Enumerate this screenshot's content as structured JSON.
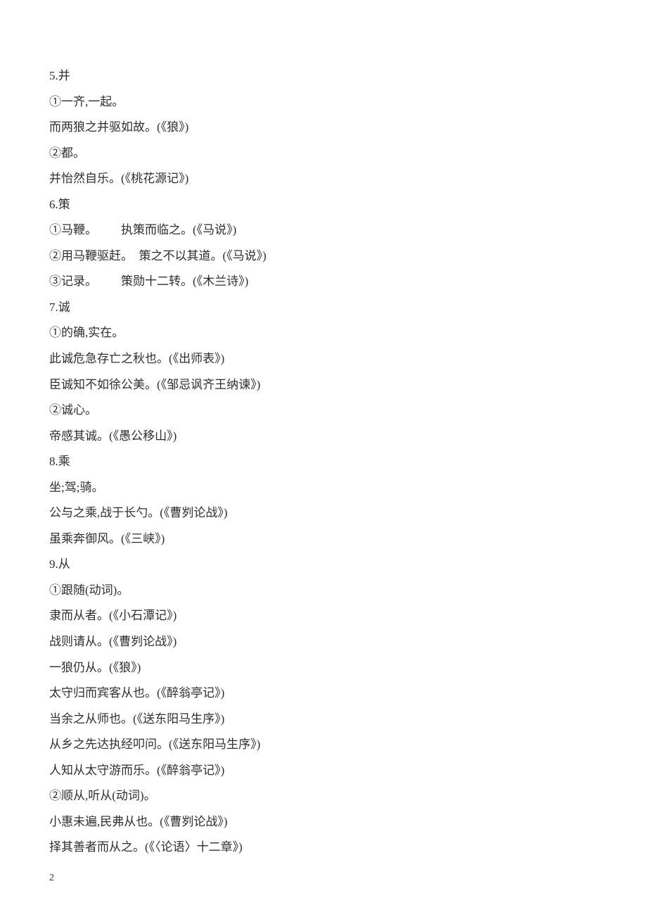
{
  "lines": [
    "5.并",
    "①一齐,一起。",
    "而两狼之并驱如故。(《狼》)",
    "②都。",
    "并怡然自乐。(《桃花源记》)",
    "6.策",
    "①马鞭。        执策而临之。(《马说》)",
    "②用马鞭驱赶。  策之不以其道。(《马说》)",
    "③记录。        策勋十二转。(《木兰诗》)",
    "7.诚",
    "①的确,实在。",
    "此诚危急存亡之秋也。(《出师表》)",
    "臣诚知不如徐公美。(《邹忌讽齐王纳谏》)",
    "②诚心。",
    "帝感其诚。(《愚公移山》)",
    "8.乘",
    "坐;驾;骑。",
    "公与之乘,战于长勺。(《曹刿论战》)",
    "虽乘奔御风。(《三峡》)",
    "9.从",
    "①跟随(动词)。",
    "隶而从者。(《小石潭记》)",
    "战则请从。(《曹刿论战》)",
    "一狼仍从。(《狼》)",
    "太守归而宾客从也。(《醉翁亭记》)",
    "当余之从师也。(《送东阳马生序》)",
    "从乡之先达执经叩问。(《送东阳马生序》)",
    "人知从太守游而乐。(《醉翁亭记》)",
    "②顺从,听从(动词)。",
    "小惠未遍,民弗从也。(《曹刿论战》)",
    "择其善者而从之。(《〈论语〉十二章》)"
  ],
  "pageNumber": "2"
}
